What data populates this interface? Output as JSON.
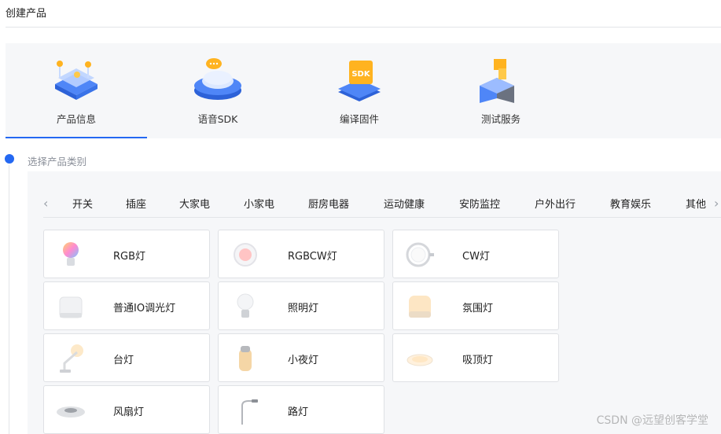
{
  "page": {
    "title": "创建产品"
  },
  "steps": [
    {
      "label": "产品信息",
      "icon": "product-info-icon",
      "active": true
    },
    {
      "label": "语音SDK",
      "icon": "voice-sdk-icon",
      "active": false
    },
    {
      "label": "编译固件",
      "icon": "compile-firmware-icon",
      "active": false
    },
    {
      "label": "测试服务",
      "icon": "test-service-icon",
      "active": false
    }
  ],
  "section": {
    "label": "选择产品类别"
  },
  "tabs": [
    "开关",
    "插座",
    "大家电",
    "小家电",
    "厨房电器",
    "运动健康",
    "安防监控",
    "户外出行",
    "教育娱乐",
    "其他"
  ],
  "products": [
    {
      "name": "RGB灯",
      "icon": "rgb-bulb-icon"
    },
    {
      "name": "RGBCW灯",
      "icon": "rgbcw-light-icon"
    },
    {
      "name": "CW灯",
      "icon": "cw-ring-light-icon"
    },
    {
      "name": "普通IO调光灯",
      "icon": "io-dimmer-light-icon"
    },
    {
      "name": "照明灯",
      "icon": "lighting-bulb-icon"
    },
    {
      "name": "氛围灯",
      "icon": "ambient-light-icon"
    },
    {
      "name": "台灯",
      "icon": "desk-lamp-icon"
    },
    {
      "name": "小夜灯",
      "icon": "night-light-icon"
    },
    {
      "name": "吸顶灯",
      "icon": "ceiling-light-icon"
    },
    {
      "name": "风扇灯",
      "icon": "fan-light-icon"
    },
    {
      "name": "路灯",
      "icon": "street-light-icon"
    }
  ],
  "watermark": "CSDN @远望创客学堂",
  "colors": {
    "accent": "#2468f2",
    "panel": "#f6f7f9",
    "border": "#dfe1e5"
  }
}
